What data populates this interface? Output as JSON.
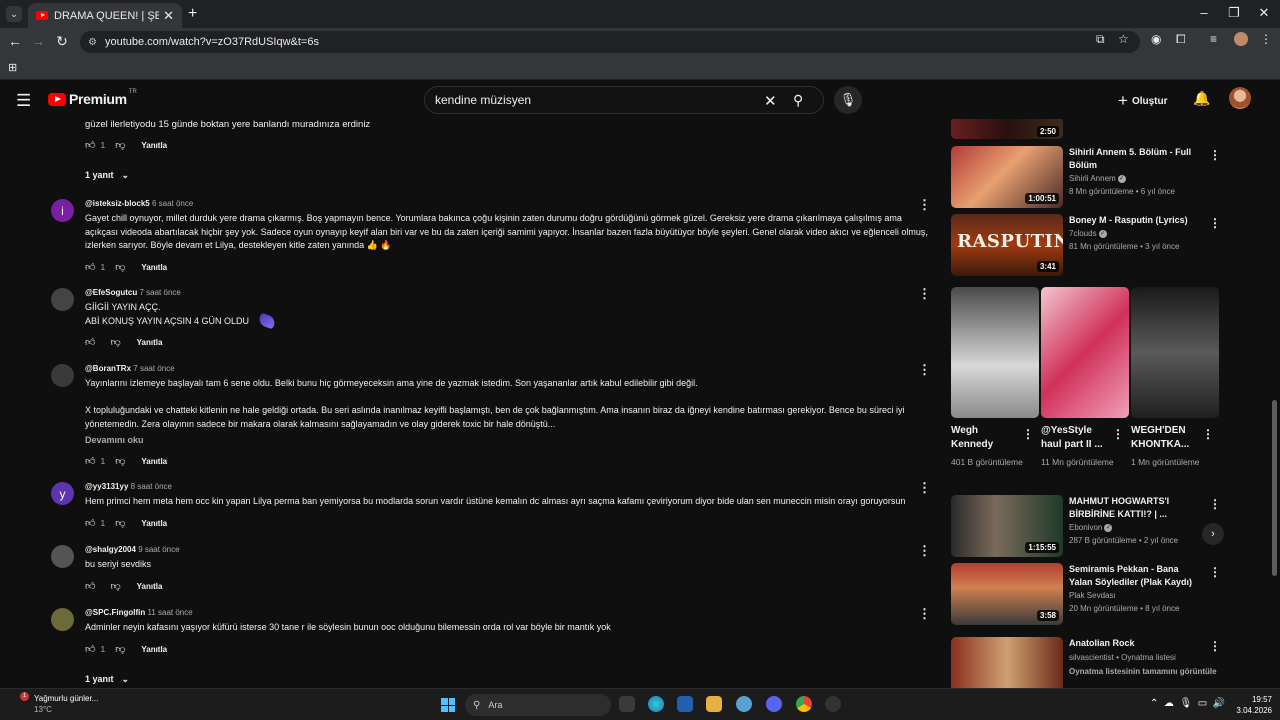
{
  "browser": {
    "tab_title": "DRAMA QUEEN! | ŞEHMUS'UN",
    "url": "youtube.com/watch?v=zO37RdUSIqw&t=6s"
  },
  "header": {
    "logo_text": "Premium",
    "logo_suffix": "TR",
    "search_value": "kendine müzisyen",
    "create_label": "Oluştur"
  },
  "comments": {
    "prev_tail": "güzel ilerletiyodu 15 günde boktan yere banlandı muradınıza erdiniz",
    "prev_likes": "1",
    "prev_replies": "1 yanıt",
    "reply_label": "Yanıtla",
    "read_more": "Devamını oku",
    "items": [
      {
        "avatar": "i",
        "avatar_color": "#7b1fa2",
        "author": "@isteksiz-block5",
        "time": "6 saat önce",
        "text": "Gayet chill oynuyor, millet durduk yere drama çıkarmış. Boş yapmayın bence. Yorumlara bakınca çoğu kişinin zaten durumu doğru gördüğünü görmek güzel. Gereksiz yere drama çıkarılmaya çalışılmış ama açıkçası videoda abartılacak hiçbir şey yok. Sadece oyun oynayıp keyif alan biri var ve bu da zaten içeriği samimi yapıyor. İnsanlar bazen fazla büyütüyor böyle şeyleri. Genel olarak video akıcı ve eğlenceli olmuş, izlerken sarıyor. Böyle devam et Lilya, destekleyen kitle zaten yanında 👍 🔥",
        "likes": "1"
      },
      {
        "avatar": "",
        "avatar_color": "#444444",
        "author": "@EfeSogutcu",
        "time": "7 saat önce",
        "text_line1": "GİİGİİ YAYIN AÇÇ.",
        "text_line2": "ABİ KONUŞ YAYIN AÇSIN 4 GÜN OLDU",
        "likes": ""
      },
      {
        "avatar": "",
        "avatar_color": "#3a3a3a",
        "author": "@BoranTRx",
        "time": "7 saat önce",
        "text_p1": "Yayınlarını izlemeye başlayalı tam 6 sene oldu. Belki bunu hiç görmeyeceksin ama yine de yazmak istedim. Son yaşananlar artık kabul edilebilir gibi değil.",
        "text_p2": "X topluluğundaki ve chatteki kitlenin ne hale geldiği ortada. Bu seri aslında inanılmaz keyifli başlamıştı, ben de çok bağlanmıştım. Ama insanın biraz da iğneyi kendine batırması gerekiyor. Bence bu süreci iyi yönetemedin. Zera olayının sadece bir makara olarak kalmasını sağlayamadın ve olay giderek toxic bir hale dönüştü...",
        "likes": "1"
      },
      {
        "avatar": "y",
        "avatar_color": "#5e35b1",
        "author": "@yy3131yy",
        "time": "8 saat önce",
        "text": "Hem primci hem meta hem occ kin yapan Lilya perma ban yemiyorsa bu modlarda sorun vardır üstüne kemalın dc alması ayrı saçma kafamı çeviriyorum  diyor bide ulan sen muneccin misin orayı goruyorsun",
        "likes": "1"
      },
      {
        "avatar": "",
        "avatar_color": "#555555",
        "author": "@shalgy2004",
        "time": "9 saat önce",
        "text": "bu seriyi sevdiks",
        "likes": ""
      },
      {
        "avatar": "",
        "avatar_color": "#6d6a3a",
        "author": "@SPC.Fingolfin",
        "time": "11 saat önce",
        "text": "Adminler neyin kafasını yaşıyor küfürü isterse 30 tane r ile söylesin bunun ooc olduğunu bilemessin orda rol var böyle bir mantık yok",
        "likes": "1",
        "replies": "1 yanıt"
      }
    ]
  },
  "sidebar": {
    "top_partial": {
      "duration": "2:50"
    },
    "videos": [
      {
        "title": "Sihirli Annem 5. Bölüm - Full Bölüm",
        "channel": "Sihirli Annem",
        "verified": true,
        "meta": "8 Mn görüntüleme • 6 yıl önce",
        "duration": "1:00:51"
      },
      {
        "title": "Boney M - Rasputin (Lyrics)",
        "channel": "7clouds",
        "verified": true,
        "meta": "81 Mn görüntüleme • 3 yıl önce",
        "duration": "3:41"
      }
    ],
    "shorts": [
      {
        "title": "Wegh Kennedy",
        "views": "401 B görüntüleme"
      },
      {
        "title": "@YesStyle haul part II ...",
        "views": "11 Mn görüntüleme"
      },
      {
        "title": "WEGH'DEN KHONTKA...",
        "views": "1 Mn görüntüleme"
      }
    ],
    "videos2": [
      {
        "title": "MAHMUT HOGWARTS'I BİRBİRİNE KATTI!? | ...",
        "channel": "Ebonivon",
        "verified": true,
        "meta": "287 B görüntüleme • 2 yıl önce",
        "duration": "1:15:55"
      },
      {
        "title": "Semiramis Pekkan - Bana Yalan Söylediler (Plak Kaydı)",
        "channel": "Plak Sevdası",
        "verified": false,
        "meta": "20 Mn görüntüleme • 8 yıl önce",
        "duration": "3:58"
      },
      {
        "title": "Anatolian Rock",
        "channel": "silvascientist • Oynatma listesi",
        "verified": false,
        "meta": "Oynatma listesinin tamamını görüntüle",
        "duration": ""
      }
    ]
  },
  "taskbar": {
    "weather_title": "Yağmurlu günler...",
    "weather_temp": "13°C",
    "weather_badge": "1",
    "search_label": "Ara",
    "time": "19:57",
    "date": "3.04.2026"
  },
  "colors": {
    "accent": "#ff0000",
    "background": "#0f0f0f"
  }
}
